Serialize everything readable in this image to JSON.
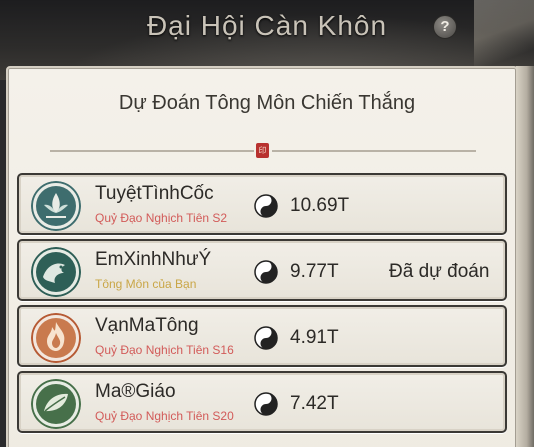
{
  "header": {
    "title": "Đại Hội Càn Khôn",
    "help_label": "?"
  },
  "panel": {
    "title": "Dự Đoán Tông Môn Chiến Thắng",
    "seal_glyph": "印"
  },
  "sects": [
    {
      "name": "TuyệtTìnhCốc",
      "subtitle": "Quỷ Đạo Nghịch Tiên S2",
      "subtitle_color": "#d25b59",
      "value": "10.69T",
      "status": "",
      "emblem_icon": "lotus-emblem-icon",
      "emblem_color": "#3e6d6e"
    },
    {
      "name": "EmXinhNhưÝ",
      "subtitle": "Tông Môn của Bạn",
      "subtitle_color": "#c9a646",
      "value": "9.77T",
      "status": "Đã dự đoán",
      "emblem_icon": "dragon-emblem-icon",
      "emblem_color": "#2e5f57"
    },
    {
      "name": "VạnMaTông",
      "subtitle": "Quỷ Đạo Nghịch Tiên S16",
      "subtitle_color": "#d25b59",
      "value": "4.91T",
      "status": "",
      "emblem_icon": "flame-emblem-icon",
      "emblem_color": "#b65a34"
    },
    {
      "name": "Ma®Giáo",
      "subtitle": "Quỷ Đạo Nghịch Tiên S20",
      "subtitle_color": "#d25b59",
      "value": "7.42T",
      "status": "",
      "emblem_icon": "leaf-emblem-icon",
      "emblem_color": "#47704a"
    }
  ]
}
